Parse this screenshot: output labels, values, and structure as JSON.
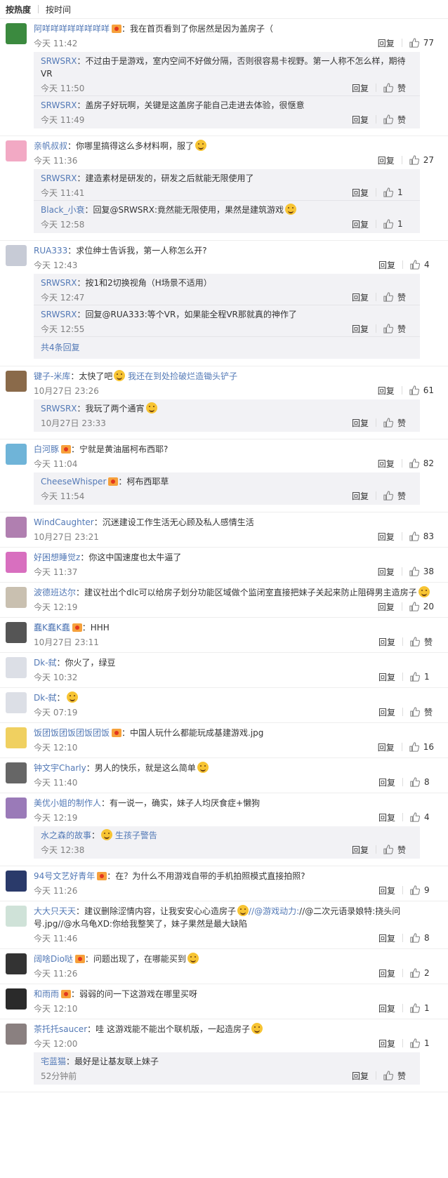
{
  "tabs": [
    "按热度",
    "按时间"
  ],
  "reply_label": "回复",
  "like_label": "赞",
  "comments": [
    {
      "nick": "阿咩咩咩咩咩咩咩咩",
      "badge": true,
      "text": "：我在首页看到了你居然是因为盖房子（",
      "time": "今天 11:42",
      "likes": "77",
      "avatar": "#3b8a3f",
      "subs": [
        {
          "nick": "SRWSRX",
          "text": "：不过由于是游戏，室内空间不好做分隔，否则很容易卡视野。第一人称不怎么样，期待VR",
          "time": "今天 11:50",
          "likes": "赞"
        },
        {
          "nick": "SRWSRX",
          "text": "：盖房子好玩啊，关键是这盖房子能自己走进去体验，很惬意",
          "time": "今天 11:49",
          "likes": "赞"
        }
      ]
    },
    {
      "nick": "亲帆叔叔",
      "badge": false,
      "text": "：你哪里搞得这么多材料啊，服了",
      "emoji": true,
      "time": "今天 11:36",
      "likes": "27",
      "avatar": "#f2a9c4",
      "subs": [
        {
          "nick": "SRWSRX",
          "text": "：建造素材是研发的，研发之后就能无限使用了",
          "time": "今天 11:41",
          "likes": "1"
        },
        {
          "nick": "Black_小衰",
          "text": "：回复@SRWSRX:竟然能无限使用，果然是建筑游戏",
          "emoji": true,
          "time": "今天 12:58",
          "likes": "1"
        }
      ]
    },
    {
      "nick": "RUA333",
      "badge": false,
      "text": "：求位绅士告诉我，第一人称怎么开?",
      "time": "今天 12:43",
      "likes": "4",
      "avatar": "#c7cbd6",
      "subs": [
        {
          "nick": "SRWSRX",
          "text": "：按1和2切换视角（H场景不适用）",
          "time": "今天 12:47",
          "likes": "赞"
        },
        {
          "nick": "SRWSRX",
          "text": "：回复@RUA333:等个VR，如果能全程VR那就真的神作了",
          "time": "今天 12:55",
          "likes": "赞"
        }
      ],
      "more": "共4条回复"
    },
    {
      "nick": "键子-米库",
      "badge": false,
      "text": "：太快了吧",
      "text2": " 我还在到处捡破烂造锄头铲子",
      "emoji": true,
      "time": "10月27日 23:26",
      "likes": "61",
      "avatar": "#8a6a4a",
      "subs": [
        {
          "nick": "SRWSRX",
          "text": "：我玩了两个通宵",
          "emoji": true,
          "time": "10月27日 23:33",
          "likes": "赞"
        }
      ]
    },
    {
      "nick": "白河豚",
      "badge": true,
      "text": "：宁就是黄油届柯布西耶?",
      "time": "今天 11:04",
      "likes": "82",
      "avatar": "#6fb4d8",
      "subs": [
        {
          "nick": "CheeseWhisper",
          "badge": true,
          "text": "：柯布西耶草",
          "time": "今天 11:54",
          "likes": "赞"
        }
      ]
    },
    {
      "nick": "WindCaughter",
      "badge": false,
      "text": "：沉迷建设工作生活无心顾及私人感情生活",
      "time": "10月27日 23:21",
      "likes": "83",
      "avatar": "#b07fb0",
      "subs": []
    },
    {
      "nick": "好困想睡觉z",
      "badge": false,
      "text": "：你这中国速度也太牛逼了",
      "time": "今天 11:37",
      "likes": "38",
      "avatar": "#d86fbf",
      "subs": []
    },
    {
      "nick": "波德班达尔",
      "badge": false,
      "text": "：建议社出个dlc可以给房子划分功能区域做个监闭室直接把妹子关起来防止阻碍男主造房子",
      "emoji": true,
      "text_line2": true,
      "time": "今天 12:19",
      "likes": "20",
      "avatar": "#c9c0b0",
      "subs": []
    },
    {
      "nick": "蠢K蠢K蠢",
      "badge": true,
      "text": "：HHH",
      "time": "10月27日 23:11",
      "likes": "赞",
      "avatar": "#555555",
      "subs": []
    },
    {
      "nick": "Dk-弑",
      "badge": false,
      "text": "：你火了，绿豆",
      "time": "今天 10:32",
      "likes": "1",
      "avatar": "#dcdfe6",
      "subs": []
    },
    {
      "nick": "Dk-弑",
      "badge": false,
      "text": "：",
      "emoji": true,
      "time": "今天 07:19",
      "likes": "赞",
      "avatar": "#dcdfe6",
      "subs": []
    },
    {
      "nick": "饭团饭团饭团饭团饭",
      "badge": true,
      "text": "：中国人玩什么都能玩成基建游戏.jpg",
      "time": "今天 12:10",
      "likes": "16",
      "avatar": "#f0d060",
      "subs": []
    },
    {
      "nick": "钟文宇Charly",
      "badge": false,
      "text": "：男人的快乐，就是这么简单",
      "emoji": true,
      "time": "今天 11:40",
      "likes": "8",
      "avatar": "#666666",
      "subs": []
    },
    {
      "nick": "美优小姐的制作人",
      "badge": false,
      "text": "：有一说一，确实，妹子人均厌食症+懒狗",
      "time": "今天 12:19",
      "likes": "4",
      "avatar": "#9a7ab8",
      "subs": [
        {
          "nick": "水之森的故事",
          "badge": false,
          "text": "：",
          "emoji": true,
          "text2": " 生孩子警告",
          "time": "今天 12:38",
          "likes": "赞"
        }
      ]
    },
    {
      "nick": "94号文艺好青年",
      "badge": true,
      "text": "：在？为什么不用游戏自带的手机拍照模式直接拍照?",
      "time": "今天 11:26",
      "likes": "9",
      "avatar": "#2a3a6a",
      "subs": []
    },
    {
      "nick": "大大只天天",
      "badge": false,
      "text": "：建议删除涩情内容，让我安安心心造房子",
      "emoji": true,
      "text2": "//@游戏动力:",
      "text3": "//@二次元语录娘特:挠头问号.jpg//@水乌龟XD:你给我整笑了，妹子果然是最大缺陷",
      "time": "今天 11:46",
      "likes": "8",
      "avatar": "#cfe2d8",
      "subs": []
    },
    {
      "nick": "阔啥Dio哒",
      "badge": true,
      "text": "：问题出现了，在哪能买到",
      "emoji": true,
      "time": "今天 11:26",
      "likes": "2",
      "avatar": "#333333",
      "subs": []
    },
    {
      "nick": "和雨雨",
      "badge": true,
      "text": "：弱弱的问一下这游戏在哪里买呀",
      "time": "今天 12:10",
      "likes": "1",
      "avatar": "#2a2a2a",
      "subs": []
    },
    {
      "nick": "茶托托saucer",
      "badge": false,
      "text": "：哇 这游戏能不能出个联机版，一起造房子",
      "emoji": true,
      "time": "今天 12:00",
      "likes": "1",
      "avatar": "#8a8080",
      "subs": [
        {
          "nick": "宅蓝猫",
          "text": "：最好是让基友联上妹子",
          "time": "52分钟前",
          "likes": "赞"
        }
      ]
    }
  ]
}
